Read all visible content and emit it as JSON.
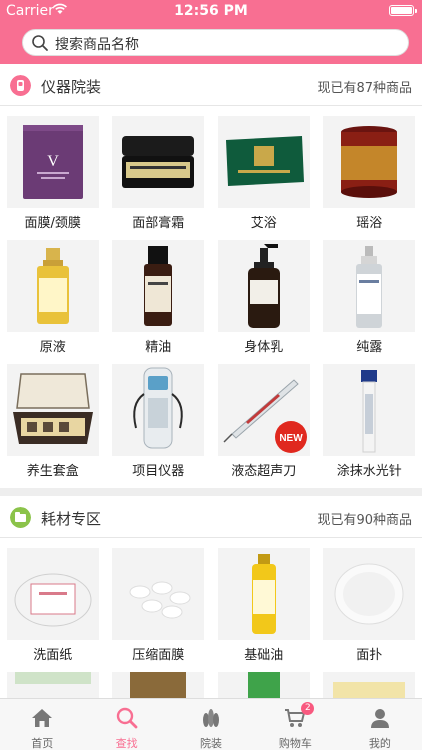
{
  "status_bar": {
    "carrier": "Carrier",
    "time": "12:56 PM"
  },
  "search": {
    "placeholder": "搜索商品名称"
  },
  "sections": [
    {
      "title": "仪器院装",
      "count_text": "现已有87种商品",
      "icon": "instrument-icon",
      "icon_color": "#f86f92",
      "items": [
        {
          "label": "面膜/颈膜",
          "name": "face-mask"
        },
        {
          "label": "面部膏霜",
          "name": "face-cream"
        },
        {
          "label": "艾浴",
          "name": "mugwort-bath"
        },
        {
          "label": "瑶浴",
          "name": "yao-bath"
        },
        {
          "label": "原液",
          "name": "serum"
        },
        {
          "label": "精油",
          "name": "essential-oil"
        },
        {
          "label": "身体乳",
          "name": "body-lotion"
        },
        {
          "label": "纯露",
          "name": "hydrosol"
        },
        {
          "label": "养生套盒",
          "name": "wellness-box"
        },
        {
          "label": "项目仪器",
          "name": "instrument"
        },
        {
          "label": "液态超声刀",
          "name": "ultrasonic-knife",
          "badge": "NEW"
        },
        {
          "label": "涂抹水光针",
          "name": "hydra-needle"
        }
      ]
    },
    {
      "title": "耗材专区",
      "count_text": "现已有90种商品",
      "icon": "consumables-icon",
      "icon_color": "#8bc34a",
      "items": [
        {
          "label": "洗面纸",
          "name": "face-towel"
        },
        {
          "label": "压缩面膜",
          "name": "compressed-mask"
        },
        {
          "label": "基础油",
          "name": "base-oil"
        },
        {
          "label": "面扑",
          "name": "puff"
        }
      ]
    }
  ],
  "tabbar": [
    {
      "label": "首页",
      "icon": "home-icon"
    },
    {
      "label": "查找",
      "icon": "search-icon",
      "active": true
    },
    {
      "label": "院装",
      "icon": "bowling-icon"
    },
    {
      "label": "购物车",
      "icon": "cart-icon",
      "badge": "2"
    },
    {
      "label": "我的",
      "icon": "user-icon"
    }
  ],
  "colors": {
    "brand": "#f86f92",
    "active_tab": "#f86f92",
    "badge": "#f8597f"
  }
}
